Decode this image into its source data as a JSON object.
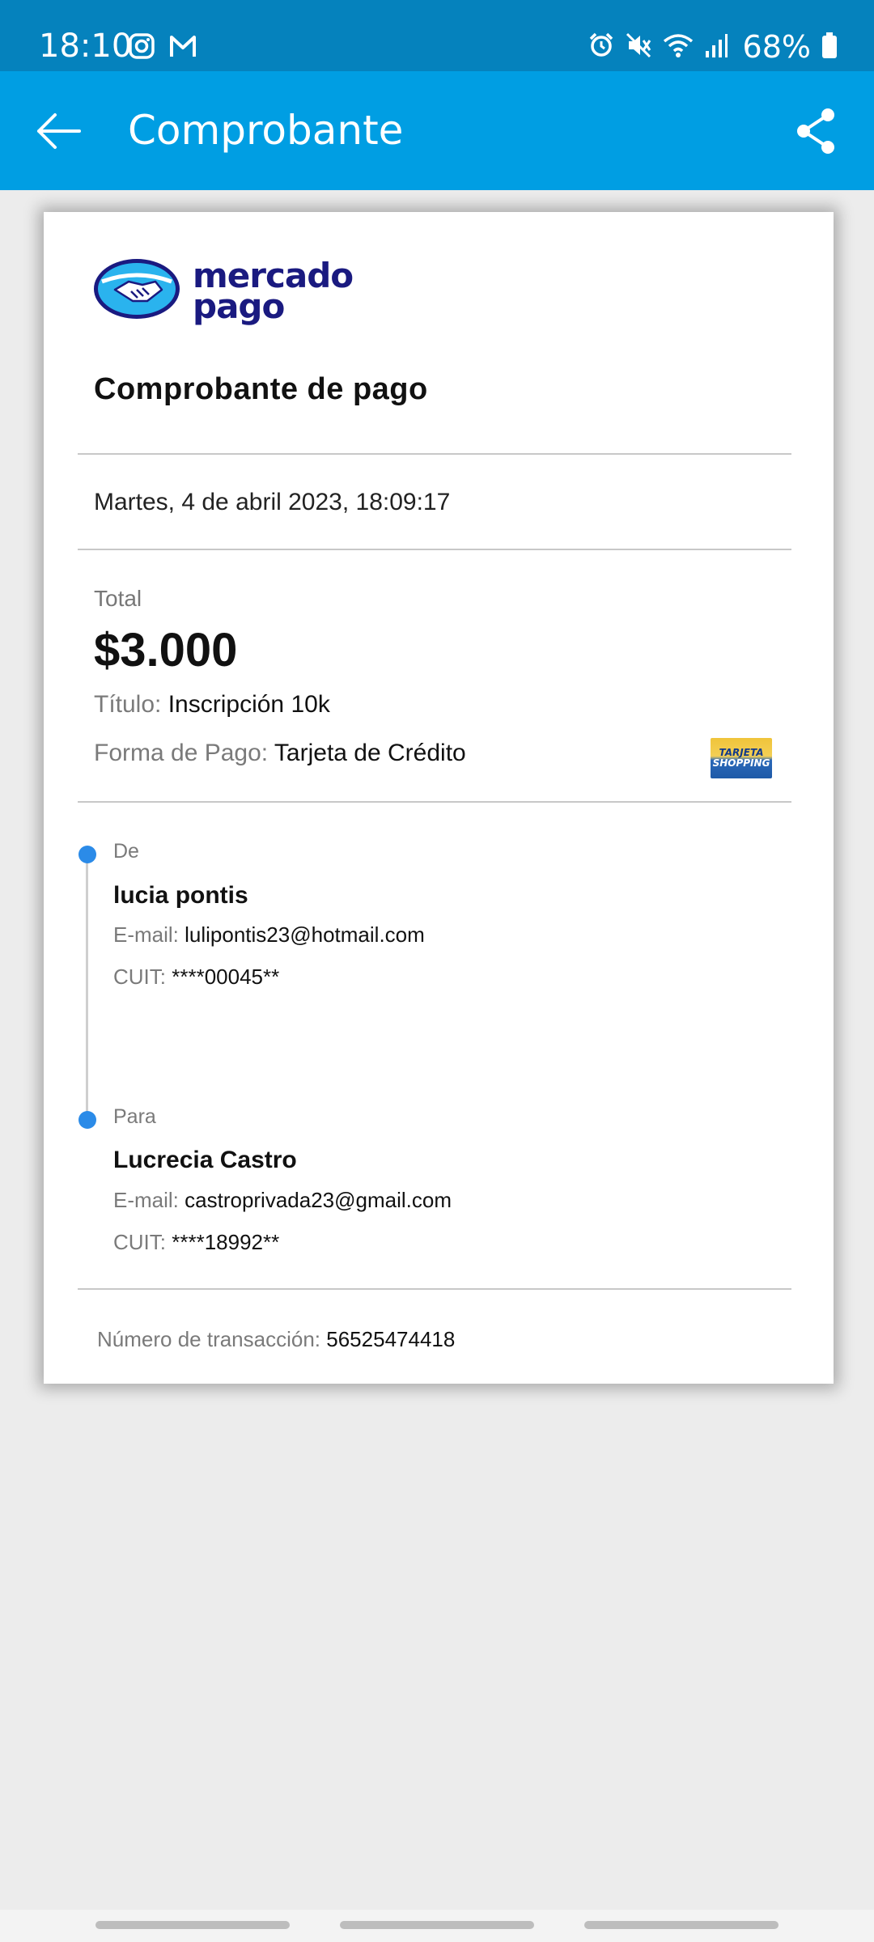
{
  "status_bar": {
    "time": "18:10",
    "battery": "68%",
    "left_icons": [
      "instagram-icon",
      "gmail-icon"
    ],
    "right_icons": [
      "alarm-icon",
      "mute-icon",
      "wifi-icon",
      "signal-icon",
      "battery-icon"
    ]
  },
  "app_bar": {
    "title": "Comprobante",
    "back_icon": "arrow-left-icon",
    "share_icon": "share-icon",
    "color": "#009ee3"
  },
  "receipt": {
    "logo_line1": "mercado",
    "logo_line2": "pago",
    "title": "Comprobante de pago",
    "date": "Martes, 4 de abril 2023, 18:09:17",
    "total_label": "Total",
    "total_amount": "$3.000",
    "titulo_label": "Título:",
    "titulo_value": "Inscripción 10k",
    "forma_label": "Forma de Pago:",
    "forma_value": "Tarjeta de Crédito",
    "card_brand_line1": "TARJETA",
    "card_brand_line2": "SHOPPING",
    "from": {
      "label": "De",
      "name": "lucia pontis",
      "email_label": "E-mail:",
      "email": "lulipontis23@hotmail.com",
      "cuit_label": "CUIT:",
      "cuit": "****00045**"
    },
    "to": {
      "label": "Para",
      "name": "Lucrecia Castro",
      "email_label": "E-mail:",
      "email": "castroprivada23@gmail.com",
      "cuit_label": "CUIT:",
      "cuit": "****18992**"
    },
    "transaction_label": "Número de transacción:",
    "transaction_number": "56525474418"
  }
}
